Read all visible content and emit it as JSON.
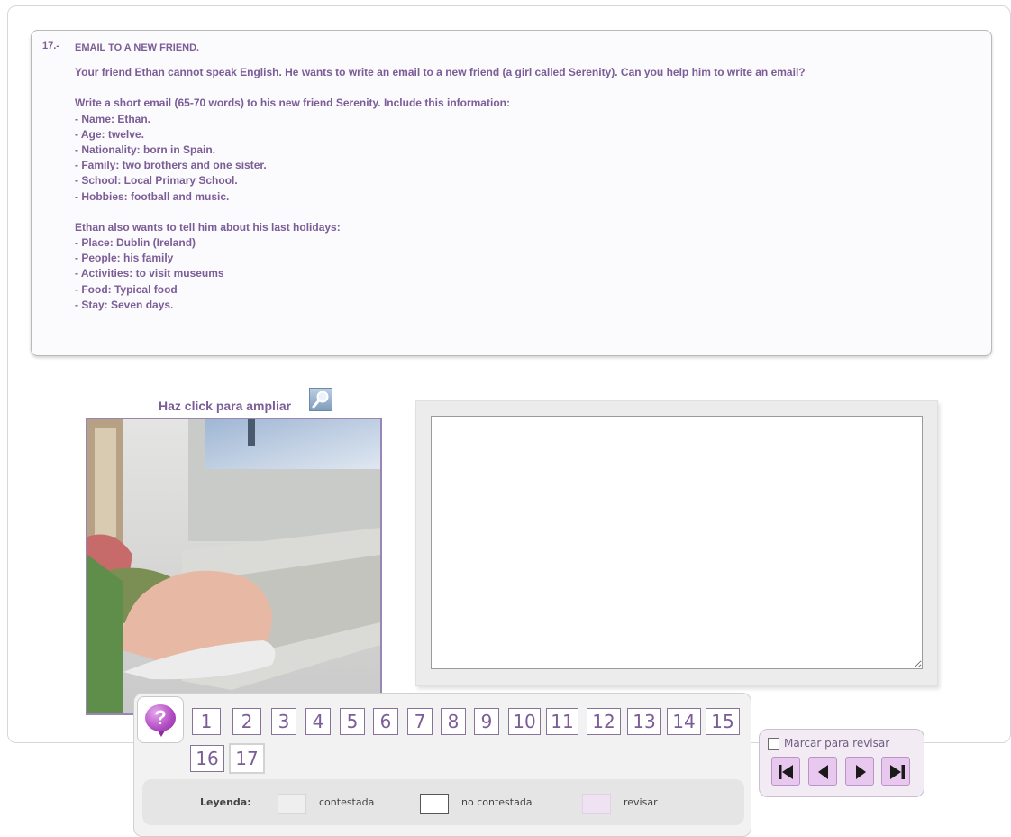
{
  "question": {
    "number": "17.-",
    "title": "EMAIL TO A NEW FRIEND.",
    "intro": "Your friend Ethan cannot speak English. He wants to write an email to a new friend (a girl called Serenity). Can you help him to write an email?",
    "block1": [
      "Write a short email (65-70 words) to his new friend Serenity. Include this information:",
      "- Name: Ethan.",
      "- Age: twelve.",
      "- Nationality: born in Spain.",
      "- Family: two brothers and one sister.",
      "- School: Local Primary School.",
      "- Hobbies: football and music."
    ],
    "block2": [
      "Ethan also wants to tell him about his last holidays:",
      "- Place: Dublin (Ireland)",
      "- People: his family",
      "- Activities: to visit museums",
      "- Food: Typical food",
      "- Stay: Seven days."
    ]
  },
  "image": {
    "caption": "Haz click para ampliar",
    "zoom_icon": "magnifier-icon"
  },
  "answer": {
    "value": ""
  },
  "navigation": {
    "help_symbol": "?",
    "help_icon": "help-bubble-icon",
    "current": 17,
    "questions": [
      "1",
      "2",
      "3",
      "4",
      "5",
      "6",
      "7",
      "8",
      "9",
      "10",
      "11",
      "12",
      "13",
      "14",
      "15",
      "16",
      "17"
    ]
  },
  "legend": {
    "title": "Leyenda:",
    "answered": "contestada",
    "unanswered": "no contestada",
    "review": "revisar",
    "colors": {
      "answered": "#efefef",
      "unanswered": "#ffffff",
      "review": "#efe3f3"
    }
  },
  "review": {
    "label": "Marcar para revisar",
    "checked": false
  },
  "nav_buttons": {
    "first": "first-icon",
    "prev": "prev-icon",
    "next": "next-icon",
    "last": "last-icon"
  },
  "colors": {
    "accent": "#7b5d97",
    "nav_button_bg": "#e9c8f0"
  }
}
